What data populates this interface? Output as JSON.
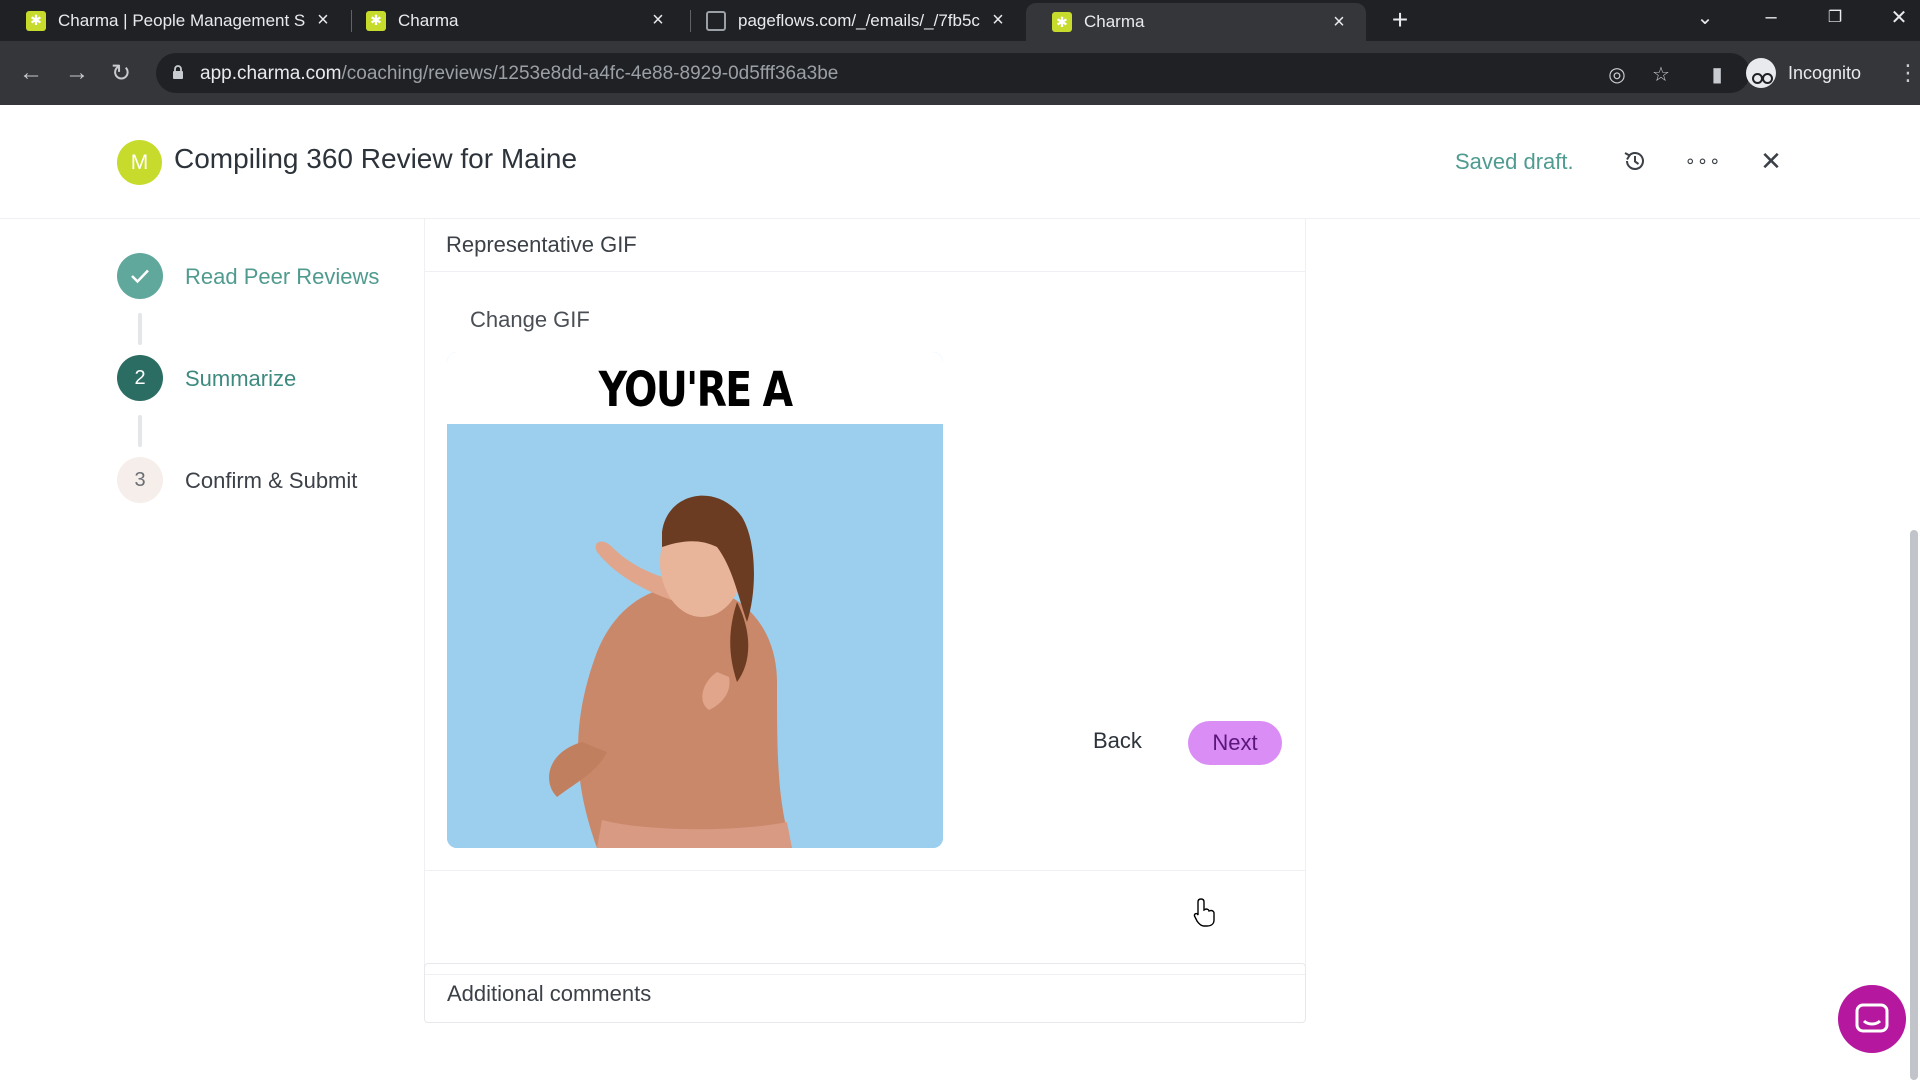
{
  "browser": {
    "tabs": [
      {
        "title": "Charma | People Management S",
        "favicon": "charma-icon",
        "active": false
      },
      {
        "title": "Charma",
        "favicon": "charma-icon",
        "active": false
      },
      {
        "title": "pageflows.com/_/emails/_/7fb5c",
        "favicon": "globe-icon",
        "active": false
      },
      {
        "title": "Charma",
        "favicon": "charma-icon",
        "active": true
      }
    ],
    "url_host": "app.charma.com",
    "url_path": "/coaching/reviews/1253e8dd-a4fc-4e88-8929-0d5fff36a3be",
    "incognito_label": "Incognito"
  },
  "header": {
    "avatar_initial": "M",
    "title": "Compiling 360 Review for Maine",
    "saved_status": "Saved draft."
  },
  "steps": [
    {
      "number": "",
      "label": "Read Peer Reviews",
      "state": "done"
    },
    {
      "number": "2",
      "label": "Summarize",
      "state": "current"
    },
    {
      "number": "3",
      "label": "Confirm & Submit",
      "state": "todo"
    }
  ],
  "gif_section": {
    "label": "Representative GIF",
    "change_label": "Change GIF",
    "gif_caption": "YOU'RE A ROCKSTAR!"
  },
  "actions": {
    "back_label": "Back",
    "next_label": "Next"
  },
  "comments": {
    "label": "Additional comments"
  },
  "colors": {
    "brand_lime": "#c6db2c",
    "teal_done": "#61a89c",
    "teal_current": "#2b6d63",
    "next_button": "#d98df5",
    "chat_bubble": "#b5179e"
  }
}
